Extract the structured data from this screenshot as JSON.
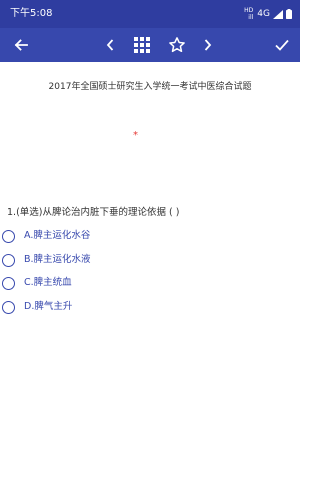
{
  "status_bar": {
    "time": "下午5:08",
    "net_top": "HD",
    "net_bottom": "ill",
    "signal": "4G",
    "icons": [
      "signal-bars-icon",
      "battery-icon"
    ]
  },
  "toolbar": {
    "icons": [
      "back-arrow-icon",
      "previous-chevron-icon",
      "grid-icon",
      "star-outline-icon",
      "next-chevron-icon",
      "check-icon"
    ]
  },
  "paper": {
    "title": "2017年全国硕士研究生入学统一考试中医综合试题",
    "marker": "*"
  },
  "question": {
    "text": "1.(单选)从脾论治内脏下垂的理论依据 ( )",
    "options": [
      {
        "label": "A.脾主运化水谷"
      },
      {
        "label": "B.脾主运化水液"
      },
      {
        "label": "C.脾主统血"
      },
      {
        "label": "D.脾气主升"
      }
    ]
  },
  "colors": {
    "status_bar_bg": "#2f3da0",
    "toolbar_bg": "#3748ad",
    "accent": "#3748ad",
    "marker": "#e53935",
    "text": "#333333"
  }
}
